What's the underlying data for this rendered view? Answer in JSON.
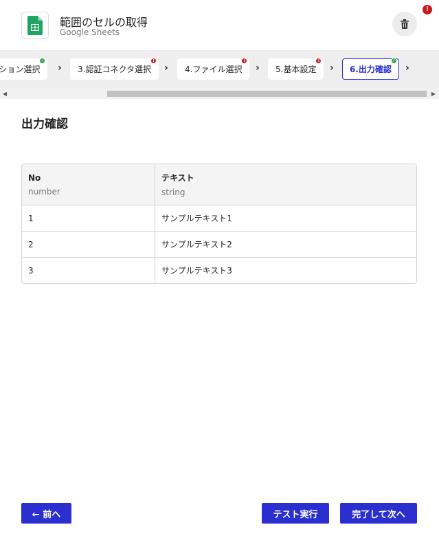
{
  "header": {
    "title": "範囲のセルの取得",
    "subtitle": "Google Sheets",
    "app_icon": "google-sheets-icon",
    "delete_icon": "trash-icon",
    "alert_badge": "!"
  },
  "steps": [
    {
      "label": "アクション選択",
      "status": "ok",
      "active": false
    },
    {
      "label": "3.認証コネクタ選択",
      "status": "error",
      "active": false
    },
    {
      "label": "4.ファイル選択",
      "status": "error",
      "active": false
    },
    {
      "label": "5.基本設定",
      "status": "error",
      "active": false
    },
    {
      "label": "6.出力確認",
      "status": "ok",
      "active": true
    }
  ],
  "main": {
    "section_title": "出力確認",
    "table": {
      "columns": [
        {
          "name": "No",
          "type": "number"
        },
        {
          "name": "テキスト",
          "type": "string"
        }
      ],
      "rows": [
        [
          "1",
          "サンプルテキスト1"
        ],
        [
          "2",
          "サンプルテキスト2"
        ],
        [
          "3",
          "サンプルテキスト3"
        ]
      ]
    }
  },
  "footer": {
    "prev_label": "← 前へ",
    "test_label": "テスト実行",
    "next_label": "完了して次へ"
  },
  "colors": {
    "primary": "#2b2fcf",
    "ok": "#2fa34a",
    "error": "#c8191e",
    "sheets_green": "#1fa463"
  }
}
